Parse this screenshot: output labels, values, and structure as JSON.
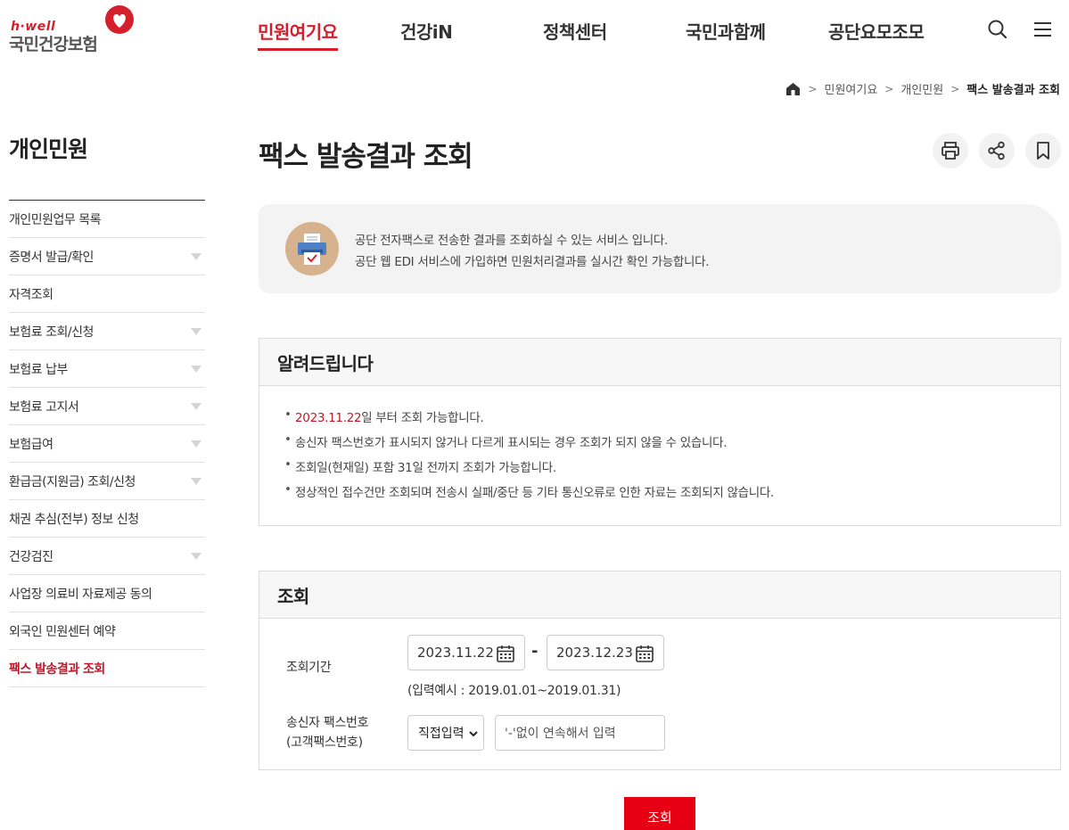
{
  "logo": {
    "tagline": "h·well",
    "name": "국민건강보험"
  },
  "gnb": [
    "민원여기요",
    "건강iN",
    "정책센터",
    "국민과함께",
    "공단요모조모"
  ],
  "header_icons": [
    "search-icon",
    "menu-icon"
  ],
  "breadcrumb": {
    "home_icon": "home-icon",
    "items": [
      "민원여기요",
      "개인민원"
    ],
    "current": "팩스 발송결과 조회"
  },
  "sidebar": {
    "title": "개인민원",
    "items": [
      {
        "label": "개인민원업무 목록",
        "expandable": false
      },
      {
        "label": "증명서 발급/확인",
        "expandable": true
      },
      {
        "label": "자격조회",
        "expandable": false
      },
      {
        "label": "보험료 조회/신청",
        "expandable": true
      },
      {
        "label": "보험료 납부",
        "expandable": true
      },
      {
        "label": "보험료 고지서",
        "expandable": true
      },
      {
        "label": "보험급여",
        "expandable": true
      },
      {
        "label": "환급금(지원금) 조회/신청",
        "expandable": true
      },
      {
        "label": "채권 추심(전부) 정보 신청",
        "expandable": false
      },
      {
        "label": "건강검진",
        "expandable": true
      },
      {
        "label": "사업장 의료비 자료제공 동의",
        "expandable": false
      },
      {
        "label": "외국인 민원센터 예약",
        "expandable": false
      },
      {
        "label": "팩스 발송결과 조회",
        "expandable": false,
        "active": true
      }
    ]
  },
  "page": {
    "title": "팩스 발송결과 조회",
    "util_icons": [
      "print-icon",
      "share-icon",
      "bookmark-icon"
    ]
  },
  "intro": {
    "icon": "fax-icon",
    "lines": [
      "공단 전자팩스로 전송한 결과를 조회하실 수 있는 서비스 입니다.",
      "공단 웹 EDI 서비스에 가입하면 민원처리결과를 실시간 확인 가능합니다."
    ]
  },
  "notice": {
    "title": "알려드립니다",
    "first_highlight": "2023.11.22",
    "first_rest": "일 부터 조회 가능합니다.",
    "items": [
      "송신자 팩스번호가 표시되지 않거나 다르게 표시되는 경우 조회가 되지 않을 수 있습니다.",
      "조회일(현재일) 포함 31일 전까지 조회가 가능합니다.",
      "정상적인 접수건만 조회되며 전송시 실패/중단 등 기타 통신오류로 인한 자료는 조회되지 않습니다."
    ]
  },
  "search": {
    "title": "조회",
    "period_label": "조회기간",
    "start_date": "2023.11.22",
    "separator": "-",
    "end_date": "2023.12.23",
    "hint": "(입력예시 : 2019.01.01~2019.01.31)",
    "fax_label_1": "송신자 팩스번호",
    "fax_label_2": "(고객팩스번호)",
    "select_value": "직접입력",
    "fax_placeholder": "'-'없이 연속해서 입력",
    "submit": "조회"
  },
  "colors": {
    "brand": "#d61f2c",
    "button": "#e60012"
  }
}
